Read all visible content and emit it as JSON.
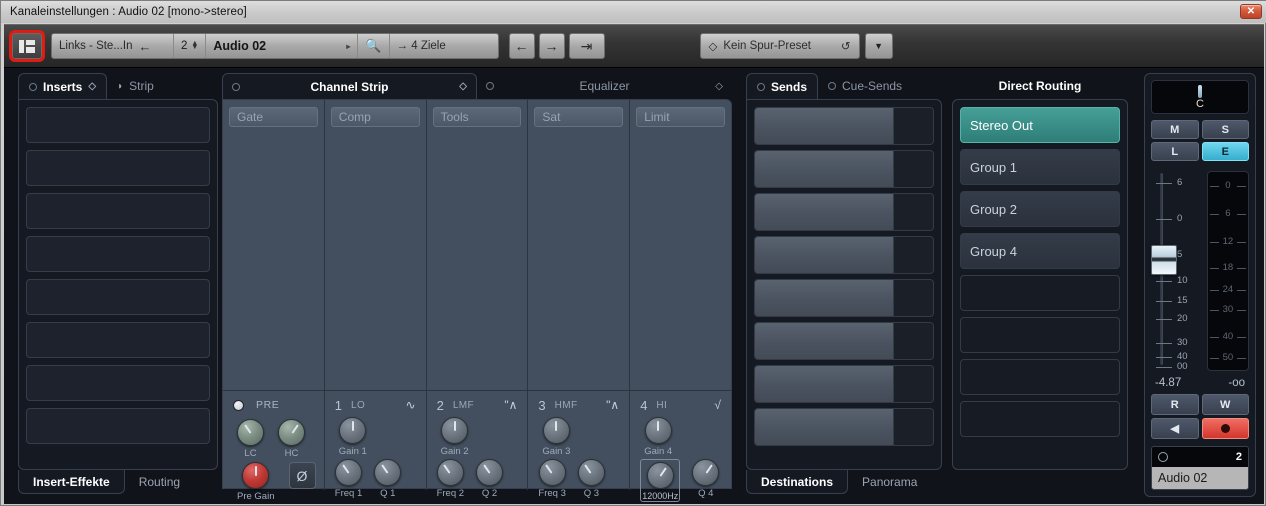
{
  "window": {
    "title": "Kanaleinstellungen : Audio 02 [mono->stereo]",
    "close_label": "✕"
  },
  "toolbar": {
    "panels_icon": "panels-icon",
    "input_routing": "Links - Ste...In",
    "input_arrow": "←",
    "channel_number": "2",
    "channel_name": "Audio 02",
    "name_tri": "▸",
    "search_icon": "🔍",
    "targets": "→ 4 Ziele",
    "prev_label": "←",
    "next_label": "→",
    "output_label": "⇥",
    "preset_icon": "◇",
    "preset_label": "Kein Spur-Preset",
    "preset_reset": "↺",
    "preset_dropdown": "▼"
  },
  "inserts": {
    "tabs": [
      {
        "label": "Inserts",
        "active": true,
        "led": true,
        "diamond": "◇"
      },
      {
        "label": "Strip",
        "active": false,
        "icon": "◗"
      }
    ],
    "slots": [
      "",
      "",
      "",
      "",
      "",
      "",
      "",
      ""
    ],
    "bottom_tabs": [
      {
        "label": "Insert-Effekte",
        "active": true
      },
      {
        "label": "Routing",
        "active": false
      }
    ]
  },
  "channel_strip": {
    "tab_label": "Channel Strip",
    "diamond": "◇",
    "modules": [
      "Gate",
      "Comp",
      "Tools",
      "Sat",
      "Limit"
    ],
    "pre": {
      "led": true,
      "title": "PRE",
      "knobs": [
        {
          "label": "LC",
          "color": "green",
          "angle": -35
        },
        {
          "label": "HC",
          "color": "green",
          "angle": 35
        },
        {
          "label": "Pre Gain",
          "color": "red",
          "angle": 0
        }
      ],
      "phase_label": "Ø"
    },
    "eq_bands": [
      {
        "num": "1",
        "type": "LO",
        "curve": "lowshelf",
        "gain_label": "Gain 1",
        "gain_angle": 0,
        "freq_label": "Freq 1",
        "freq_angle": -35,
        "q_label": "Q 1",
        "q_angle": -35,
        "freq_selected": false
      },
      {
        "num": "2",
        "type": "LMF",
        "curve": "peak",
        "gain_label": "Gain 2",
        "gain_angle": 0,
        "freq_label": "Freq 2",
        "freq_angle": -35,
        "q_label": "Q 2",
        "q_angle": -35,
        "freq_selected": false
      },
      {
        "num": "3",
        "type": "HMF",
        "curve": "peak",
        "gain_label": "Gain 3",
        "gain_angle": 0,
        "freq_label": "Freq 3",
        "freq_angle": -35,
        "q_label": "Q 3",
        "q_angle": -35,
        "freq_selected": false
      },
      {
        "num": "4",
        "type": "HI",
        "curve": "highshelf",
        "gain_label": "Gain 4",
        "gain_angle": 0,
        "freq_label": "12000Hz",
        "freq_angle": 35,
        "q_label": "Q 4",
        "q_angle": 35,
        "freq_selected": true
      }
    ]
  },
  "equalizer": {
    "tab_label": "Equalizer",
    "diamond": "◇"
  },
  "sends": {
    "tabs": [
      {
        "label": "Sends",
        "active": true
      },
      {
        "label": "Cue-Sends",
        "active": false
      }
    ],
    "slots": [
      "",
      "",
      "",
      "",
      "",
      "",
      "",
      ""
    ],
    "bottom_tabs": [
      {
        "label": "Destinations",
        "active": true
      },
      {
        "label": "Panorama",
        "active": false
      }
    ]
  },
  "direct_routing": {
    "title": "Direct Routing",
    "rows": [
      {
        "label": "Stereo Out",
        "active": true
      },
      {
        "label": "Group 1",
        "active": false
      },
      {
        "label": "Group 2",
        "active": false
      },
      {
        "label": "Group 4",
        "active": false
      },
      {
        "label": "",
        "active": false
      },
      {
        "label": "",
        "active": false
      },
      {
        "label": "",
        "active": false
      },
      {
        "label": "",
        "active": false
      }
    ]
  },
  "fader_strip": {
    "pan_value": "C",
    "buttons": [
      {
        "label": "M",
        "on": false
      },
      {
        "label": "S",
        "on": false
      },
      {
        "label": "L",
        "on": false
      },
      {
        "label": "E",
        "on": true
      }
    ],
    "fader_ticks": [
      "6",
      "0",
      "5",
      "10",
      "15",
      "20",
      "30",
      "40",
      "00"
    ],
    "meter_ticks": [
      "0",
      "6",
      "12",
      "18",
      "24",
      "30",
      "40",
      "50"
    ],
    "gain_readout": "-4.87",
    "peak_readout": "-oo",
    "automation": [
      {
        "label": "R",
        "kind": "text"
      },
      {
        "label": "W",
        "kind": "text"
      },
      {
        "label": "◀",
        "kind": "monitor"
      },
      {
        "label": "●",
        "kind": "record"
      }
    ],
    "channel_number": "2",
    "channel_name": "Audio 02"
  },
  "colors": {
    "accent_cyan": "#46b9d6",
    "routing_active": "#2f7e78",
    "record_red": "#d3362c",
    "selection_red": "#e01b12",
    "strip_body": "#434f5e"
  }
}
